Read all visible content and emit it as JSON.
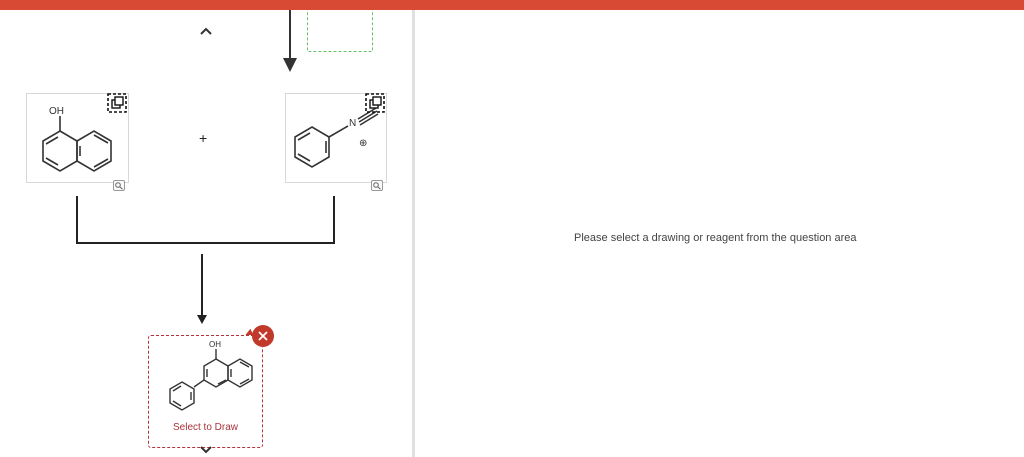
{
  "question": {
    "reactant_1": {
      "label": "OH"
    },
    "plus_sign": "+",
    "reactant_2": {
      "nitrogen_label": "N",
      "charge_label": "⊕"
    },
    "product": {
      "label": "OH",
      "action_label": "Select to Draw"
    }
  },
  "answer_panel": {
    "placeholder": "Please select a drawing or reagent from the question area"
  },
  "colors": {
    "top_bar": "#d94a35",
    "remove_button": "#c0392b",
    "draw_box_border": "#b5303a",
    "ghost_box_border": "#6abf6a"
  },
  "icons": {
    "nav_up": "chevron-up-icon",
    "nav_down": "chevron-down-icon",
    "copy": "copy-icon",
    "zoom": "zoom-icon",
    "remove": "close-icon"
  }
}
